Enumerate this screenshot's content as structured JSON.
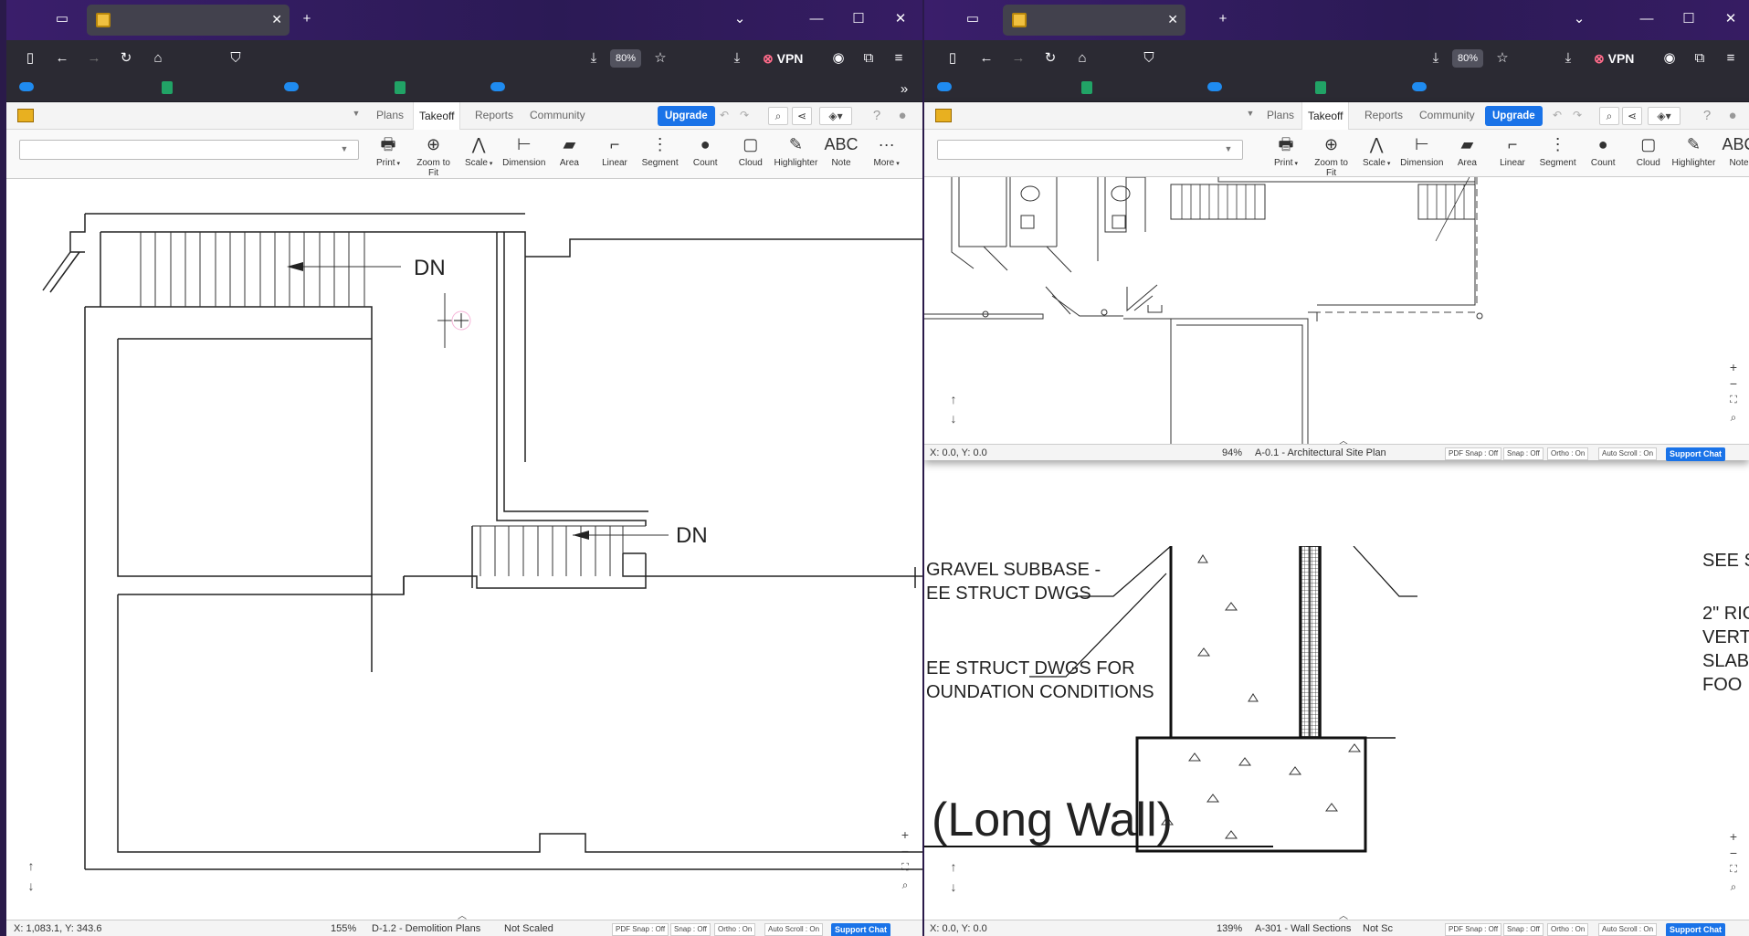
{
  "browser": {
    "zoom": "80%",
    "vpn_label": "VPN",
    "icons": [
      "firefox-view-icon",
      "tab-icon",
      "new-tab-icon",
      "list-tabs-icon",
      "minimize-icon",
      "maximize-icon",
      "close-icon",
      "sidebar-icon",
      "back-icon",
      "forward-icon",
      "reload-icon",
      "home-icon",
      "shield-icon",
      "save-page-icon",
      "star-icon",
      "download-icon",
      "account-icon",
      "extensions-icon",
      "menu-icon",
      "onedrive-icon",
      "excel-icon"
    ]
  },
  "app": {
    "menu": {
      "plans": "Plans",
      "takeoff": "Takeoff",
      "reports": "Reports",
      "community": "Community",
      "upgrade": "Upgrade"
    },
    "tools": [
      {
        "label": "Print",
        "glyph": "🖶",
        "caret": true
      },
      {
        "label": "Zoom to Fit",
        "glyph": "⊕"
      },
      {
        "label": "Scale",
        "glyph": "⋀",
        "caret": true
      },
      {
        "label": "Dimension",
        "glyph": "⊢"
      },
      {
        "label": "Area",
        "glyph": "▰"
      },
      {
        "label": "Linear",
        "glyph": "⌐"
      },
      {
        "label": "Segment",
        "glyph": "⋮"
      },
      {
        "label": "Count",
        "glyph": "●"
      },
      {
        "label": "Cloud",
        "glyph": "▢"
      },
      {
        "label": "Highlighter",
        "glyph": "✎"
      },
      {
        "label": "Note",
        "glyph": "ABC"
      },
      {
        "label": "More",
        "glyph": "···",
        "caret": true
      }
    ],
    "status_chips": {
      "pdf_snap": "PDF Snap : Off",
      "snap": "Snap : Off",
      "ortho": "Ortho : On",
      "auto_scroll": "Auto Scroll : On",
      "support": "Support Chat"
    }
  },
  "left_window": {
    "coords": "X: 1,083.1, Y: 343.6",
    "zoom": "155%",
    "sheet": "D-1.2 - Demolition Plans",
    "scale": "Not Scaled",
    "drawing_labels": [
      "DN",
      "DN"
    ]
  },
  "right_top_pane": {
    "coords": "X: 0.0, Y: 0.0",
    "zoom": "94%",
    "sheet": "A-0.1 - Architectural Site Plan"
  },
  "right_bottom_pane": {
    "coords": "X: 0.0, Y: 0.0",
    "zoom": "139%",
    "sheet": "A-301 - Wall Sections",
    "scale": "Not Sc",
    "notes": [
      "GRAVEL SUBBASE -",
      "EE STRUCT DWGS",
      "EE STRUCT DWGS FOR",
      "OUNDATION CONDITIONS",
      "SEE S",
      "2\" RIG",
      "VERT",
      "SLAB",
      "FOO"
    ],
    "title": "(Long Wall)"
  }
}
